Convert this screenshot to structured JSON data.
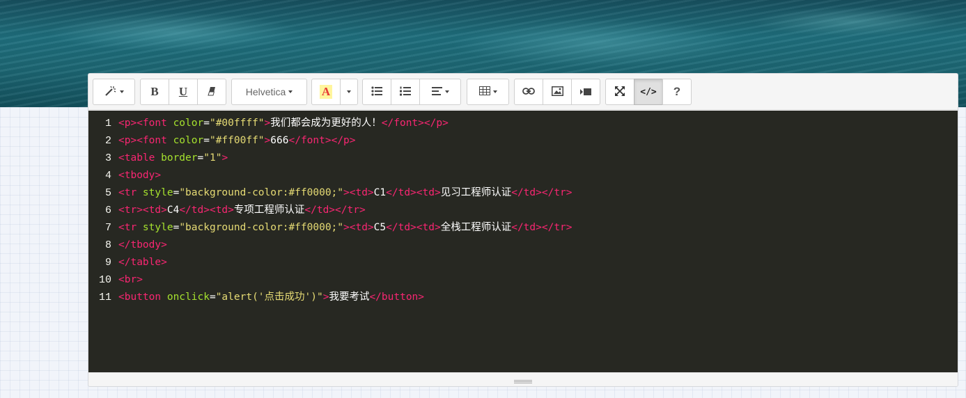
{
  "toolbar": {
    "font_name": "Helvetica",
    "color_glyph": "A",
    "help_label": "?",
    "codeview_label": "</>"
  },
  "code": {
    "lines": [
      {
        "n": "1",
        "parts": [
          [
            "tag",
            "<p><font "
          ],
          [
            "attr",
            "color"
          ],
          [
            "txt",
            "="
          ],
          [
            "str",
            "\"#00ffff\""
          ],
          [
            "tag",
            ">"
          ],
          [
            "txt",
            "我们都会成为更好的人！"
          ],
          [
            "tag",
            "</font></p>"
          ]
        ]
      },
      {
        "n": "2",
        "parts": [
          [
            "tag",
            "<p><font "
          ],
          [
            "attr",
            "color"
          ],
          [
            "txt",
            "="
          ],
          [
            "str",
            "\"#ff00ff\""
          ],
          [
            "tag",
            ">"
          ],
          [
            "txt",
            "666"
          ],
          [
            "tag",
            "</font></p>"
          ]
        ]
      },
      {
        "n": "3",
        "parts": [
          [
            "tag",
            "<table "
          ],
          [
            "attr",
            "border"
          ],
          [
            "txt",
            "="
          ],
          [
            "str",
            "\"1\""
          ],
          [
            "tag",
            ">"
          ]
        ]
      },
      {
        "n": "4",
        "parts": [
          [
            "tag",
            "<tbody>"
          ]
        ]
      },
      {
        "n": "5",
        "parts": [
          [
            "tag",
            "<tr "
          ],
          [
            "attr",
            "style"
          ],
          [
            "txt",
            "="
          ],
          [
            "str",
            "\"background-color:#ff0000;\""
          ],
          [
            "tag",
            "><td>"
          ],
          [
            "txt",
            "C1"
          ],
          [
            "tag",
            "</td><td>"
          ],
          [
            "txt",
            "见习工程师认证"
          ],
          [
            "tag",
            "</td></tr>"
          ]
        ]
      },
      {
        "n": "6",
        "parts": [
          [
            "tag",
            "<tr><td>"
          ],
          [
            "txt",
            "C4"
          ],
          [
            "tag",
            "</td><td>"
          ],
          [
            "txt",
            "专项工程师认证"
          ],
          [
            "tag",
            "</td></tr>"
          ]
        ]
      },
      {
        "n": "7",
        "parts": [
          [
            "tag",
            "<tr "
          ],
          [
            "attr",
            "style"
          ],
          [
            "txt",
            "="
          ],
          [
            "str",
            "\"background-color:#ff0000;\""
          ],
          [
            "tag",
            "><td>"
          ],
          [
            "txt",
            "C5"
          ],
          [
            "tag",
            "</td><td>"
          ],
          [
            "txt",
            "全栈工程师认证"
          ],
          [
            "tag",
            "</td></tr>"
          ]
        ]
      },
      {
        "n": "8",
        "parts": [
          [
            "tag",
            "</tbody>"
          ]
        ]
      },
      {
        "n": "9",
        "parts": [
          [
            "tag",
            "</table>"
          ]
        ]
      },
      {
        "n": "10",
        "parts": [
          [
            "tag",
            "<br>"
          ]
        ]
      },
      {
        "n": "11",
        "parts": [
          [
            "tag",
            "<button "
          ],
          [
            "attr",
            "onclick"
          ],
          [
            "txt",
            "="
          ],
          [
            "str",
            "\"alert('点击成功')\""
          ],
          [
            "tag",
            ">"
          ],
          [
            "txt",
            "我要考试"
          ],
          [
            "tag",
            "</button>"
          ]
        ]
      }
    ]
  }
}
